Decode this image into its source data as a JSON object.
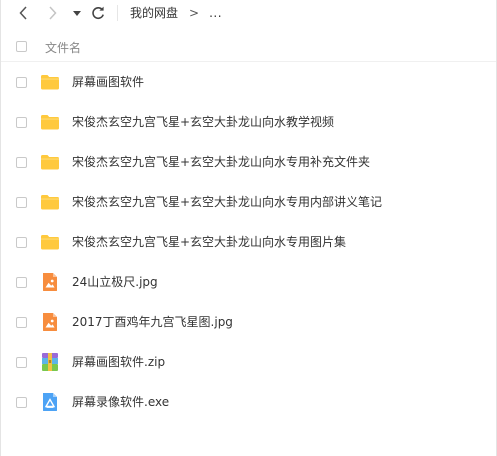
{
  "toolbar": {
    "back_icon": "chevron-left-icon",
    "forward_icon": "chevron-right-icon",
    "history_icon": "caret-down-icon",
    "refresh_icon": "refresh-icon",
    "breadcrumb_root": "我的网盘",
    "breadcrumb_arrow": ">",
    "breadcrumb_more": "..."
  },
  "list_header": {
    "name_label": "文件名"
  },
  "files": [
    {
      "name": "屏幕画图软件",
      "type": "folder"
    },
    {
      "name": "宋俊杰玄空九宫飞星+玄空大卦龙山向水教学视频",
      "type": "folder"
    },
    {
      "name": "宋俊杰玄空九宫飞星+玄空大卦龙山向水专用补充文件夹",
      "type": "folder"
    },
    {
      "name": "宋俊杰玄空九宫飞星+玄空大卦龙山向水专用内部讲义笔记",
      "type": "folder"
    },
    {
      "name": "宋俊杰玄空九宫飞星+玄空大卦龙山向水专用图片集",
      "type": "folder"
    },
    {
      "name": "24山立极尺.jpg",
      "type": "image"
    },
    {
      "name": "2017丁酉鸡年九宫飞星图.jpg",
      "type": "image"
    },
    {
      "name": "屏幕画图软件.zip",
      "type": "zip"
    },
    {
      "name": "屏幕录像软件.exe",
      "type": "exe"
    }
  ],
  "colors": {
    "folder": "#ffc93d",
    "image": "#f78d3e",
    "exe": "#4da3f5",
    "text": "#333333",
    "muted": "#888888"
  }
}
